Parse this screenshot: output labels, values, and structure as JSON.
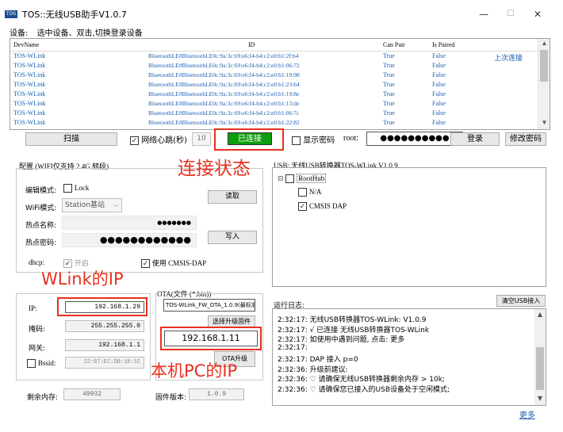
{
  "window": {
    "icon_text": "TOS",
    "title": "TOS::无线USB助手V1.0.7",
    "minimize": "—",
    "maximize": "☐",
    "close": "✕"
  },
  "device_bar": {
    "label": "设备:",
    "hint": "选中设备、双击,切换登录设备"
  },
  "device_table": {
    "columns": [
      "DevName",
      "ID",
      "Can Pair",
      "Is Paired"
    ],
    "rows": [
      {
        "name": "TOS-WLink",
        "id": "BluetoothLE#BluetoothLE0c:9a:3c:69:e6:f4-b4:c2:e0:b1:2f:b4",
        "can_pair": "True",
        "is_paired": "False",
        "extra": "上次连接"
      },
      {
        "name": "TOS-WLink",
        "id": "BluetoothLE#BluetoothLE0c:9a:3c:69:e6:f4-b4:c2:e0:b1:06:72",
        "can_pair": "True",
        "is_paired": "False",
        "extra": ""
      },
      {
        "name": "TOS-WLink",
        "id": "BluetoothLE#BluetoothLE0c:9a:3c:69:e6:f4-b4:c2:e0:b1:19:98",
        "can_pair": "True",
        "is_paired": "False",
        "extra": ""
      },
      {
        "name": "TOS-WLink",
        "id": "BluetoothLE#BluetoothLE0c:9a:3c:69:e6:f4-b4:c2:e0:b1:23:64",
        "can_pair": "True",
        "is_paired": "False",
        "extra": ""
      },
      {
        "name": "TOS-WLink",
        "id": "BluetoothLE#BluetoothLE0c:9a:3c:69:e6:f4-b4:c2:e0:b1:19:8e",
        "can_pair": "True",
        "is_paired": "False",
        "extra": ""
      },
      {
        "name": "TOS-WLink",
        "id": "BluetoothLE#BluetoothLE0c:9a:3c:69:e6:f4-b4:c2:e0:b1:13:de",
        "can_pair": "True",
        "is_paired": "False",
        "extra": ""
      },
      {
        "name": "TOS-WLink",
        "id": "BluetoothLE#BluetoothLE0c:9a:3c:69:e6:f4-b4:c2:e0:b1:06:7c",
        "can_pair": "True",
        "is_paired": "False",
        "extra": ""
      },
      {
        "name": "TOS-WLink",
        "id": "BluetoothLE#BluetoothLE0c:9a:3c:69:e6:f4-b4:c2:e0:b1:22:82",
        "can_pair": "True",
        "is_paired": "False",
        "extra": ""
      }
    ],
    "scroll_up": "▲",
    "scroll_down": "▼"
  },
  "controls": {
    "scan": "扫描",
    "heartbeat_label": "网络心跳(秒)",
    "heartbeat_value": "10",
    "status": "已连接",
    "show_password": "显示密码",
    "root_label": "root:",
    "root_password": "●●●●●●●●●●",
    "login": "登录",
    "change_password": "修改密码"
  },
  "config": {
    "title": "配置 (WIFI仅支持 2.4G 频段)",
    "edit_mode_label": "编辑模式:",
    "lock_label": "Lock",
    "wifi_mode_label": "WiFi模式:",
    "wifi_mode_value": "Station基站",
    "hotspot_name_label": "热点名称:",
    "hotspot_name_value": "●●●●●●●",
    "hotspot_password_label": "热点密码:",
    "hotspot_password_value": "●●●●●●●●●●●●",
    "read_button": "读取",
    "write_button": "写入",
    "dhcp_label": "dhcp:",
    "dhcp_checkbox": "开启",
    "cmsis_checkbox": "使用 CMSIS-DAP",
    "ip_label": "IP:",
    "ip_value": "192.168.1.29",
    "mask_label": "掩码:",
    "mask_value": "255.255.255.0",
    "gateway_label": "网关:",
    "gateway_value": "192.168.1.1",
    "bssid_label": "Bssid:",
    "bssid_value": "22:87:EC:DB:18:1C",
    "free_memory_label": "剩余内存:",
    "free_memory_value": "49932",
    "firmware_label": "固件版本:",
    "firmware_value": "1.0.9"
  },
  "ota": {
    "title": "OTA(文件 (*.bin))",
    "file_value": "TOS-WLink_FW_OTA_1.0.9(最标准",
    "choose_button": "选择升级固件",
    "host_ip": "192.168.1.11",
    "upgrade_button": "OTA升级"
  },
  "usb": {
    "title": "USB: 无线USB转换器TOS-WLink V1.0.9",
    "root": "RootHub",
    "child1": "N/A",
    "child2": "CMSIS DAP"
  },
  "log": {
    "title": "运行日志:",
    "clear_button": "清空USB接入",
    "lines": [
      "2:32:17: 无线USB转换器TOS-WLink: V1.0.9",
      "2:32:17:   √ 已连接 无线USB转换器TOS-WLink",
      "2:32:17: 如使用中遇到问题, 点击: 更多",
      "2:32:17:",
      "2:32:17: DAP 接入 p=0",
      "2:32:36: 升级前建议:",
      "2:32:36:     ♡ 请确保无线USB转换器剩余内存 > 10k;",
      "2:32:36:     ♡ 请确保您已接入的USB设备处于空闲模式;"
    ],
    "more_link": "更多"
  },
  "annotations": {
    "status": "连接状态",
    "wlink_ip": "WLink的IP",
    "host_ip": "本机PC的IP"
  },
  "colors": {
    "accent_blue": "#1a5fb4",
    "status_green": "#0d9e0d",
    "annotation_red": "#e8301e"
  }
}
